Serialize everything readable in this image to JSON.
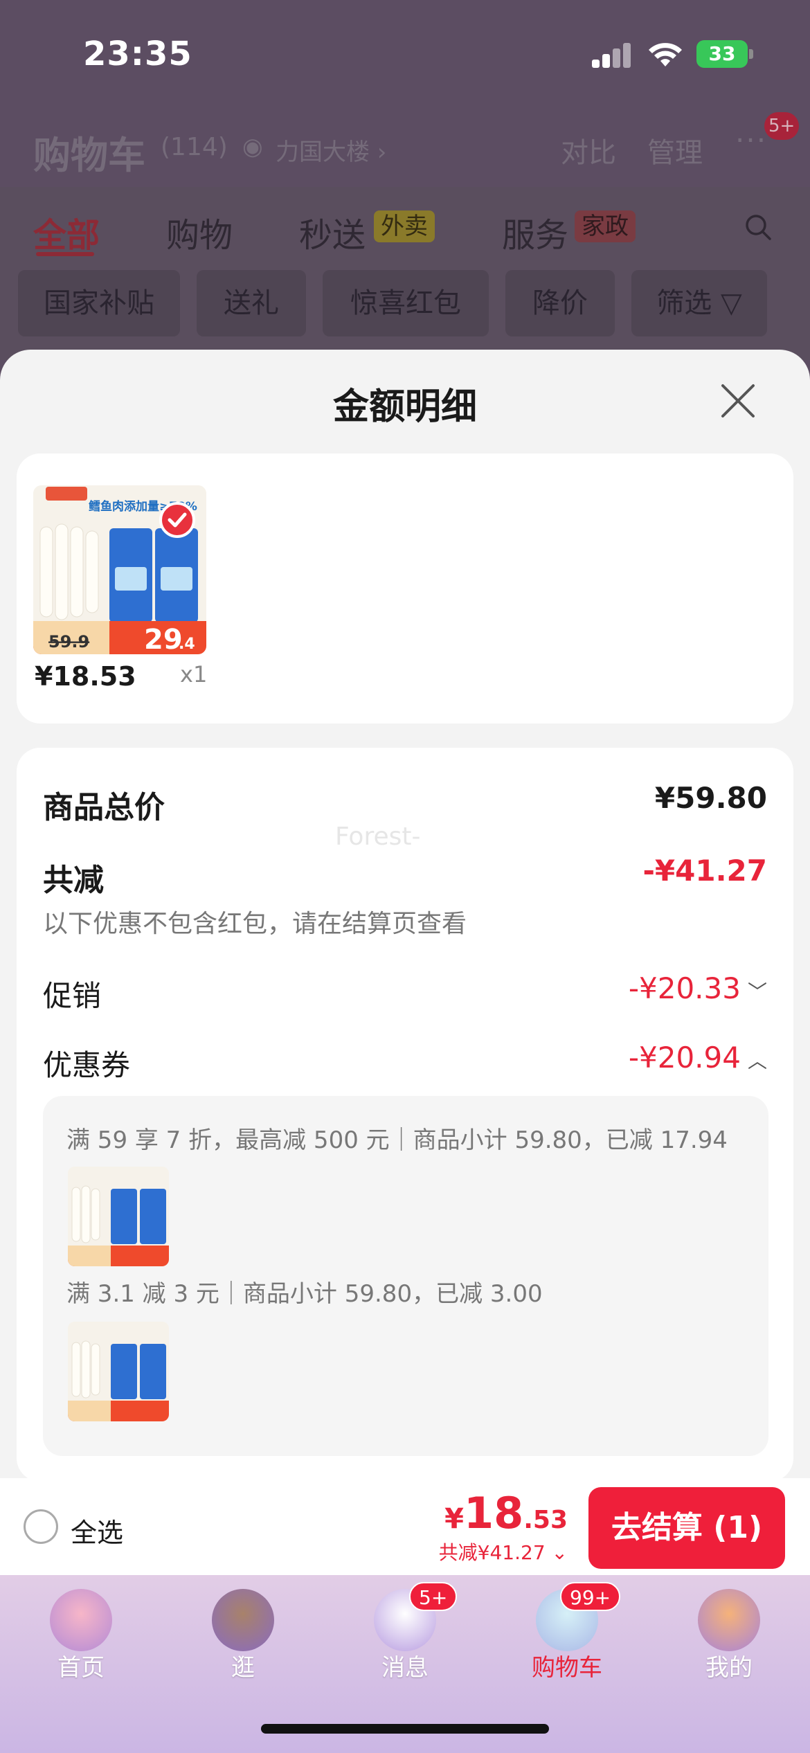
{
  "status_bar": {
    "time": "23:35",
    "battery": "33"
  },
  "cart_header": {
    "title": "购物车",
    "count": "(114)",
    "location": "力国大楼 ›",
    "compare": "对比",
    "manage": "管理",
    "badge": "5+"
  },
  "cart_tabs": {
    "all": "全部",
    "shopping": "购物",
    "express": "秒送",
    "express_tag": "外卖",
    "service": "服务",
    "service_tag": "家政"
  },
  "filter_chips": [
    "国家补贴",
    "送礼",
    "惊喜红包",
    "降价",
    "筛选 ▽"
  ],
  "sheet": {
    "title": "金额明细",
    "product": {
      "banner": "鳕鱼肉添加量≥70%",
      "old_price": "59.9",
      "promo_price": "29",
      "promo_price_dec": ".4",
      "price": "¥18.53",
      "qty": "x1"
    },
    "watermark": "Forest-",
    "total_label": "商品总价",
    "total_value": "¥59.80",
    "reduce_label": "共减",
    "reduce_value": "-¥41.27",
    "reduce_note": "以下优惠不包含红包，请在结算页查看",
    "promo_label": "促销",
    "promo_value": "-¥20.33",
    "coupon_label": "优惠券",
    "coupon_value": "-¥20.94",
    "coupon_items": [
      {
        "desc": "满 59 享 7 折，最高减 500 元｜商品小计 59.80，已减 17.94"
      },
      {
        "desc": "满 3.1 减 3 元｜商品小计 59.80，已减 3.00"
      }
    ]
  },
  "checkout": {
    "select_all": "全选",
    "currency": "¥",
    "total_int": "18",
    "total_dec": ".53",
    "saved": "共减¥41.27 ⌄",
    "button": "去结算 (1)"
  },
  "tab_bar": {
    "items": [
      {
        "label": "首页"
      },
      {
        "label": "逛"
      },
      {
        "label": "消息",
        "badge": "5+"
      },
      {
        "label": "购物车",
        "badge": "99+"
      },
      {
        "label": "我的"
      }
    ]
  },
  "colors": {
    "accent_red": "#e8243a",
    "sheet_bg": "#f3f3f3",
    "dim_bg": "#5c4d62"
  }
}
